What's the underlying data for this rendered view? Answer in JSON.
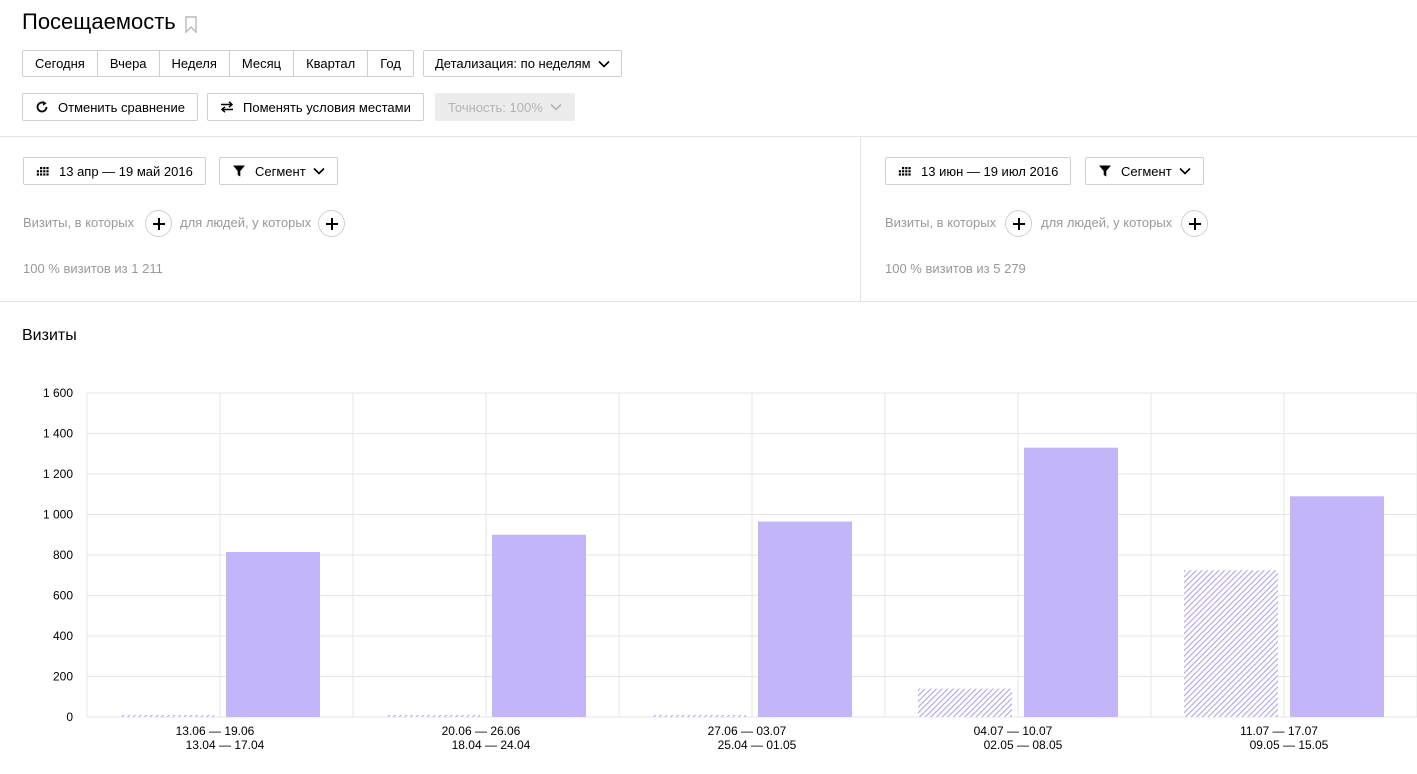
{
  "header": {
    "title": "Посещаемость"
  },
  "periods": [
    "Сегодня",
    "Вчера",
    "Неделя",
    "Месяц",
    "Квартал",
    "Год"
  ],
  "detail_label": "Детализация: по неделям",
  "actions": {
    "cancel_compare": "Отменить сравнение",
    "swap": "Поменять условия местами",
    "accuracy": "Точность: 100%"
  },
  "segment_left": {
    "date_range": "13 апр — 19 май 2016",
    "segment_label": "Сегмент",
    "visits_which": "Визиты, в которых",
    "people_which": "для людей, у которых",
    "summary": "100 % визитов из 1 211"
  },
  "segment_right": {
    "date_range": "13 июн — 19 июл 2016",
    "segment_label": "Сегмент",
    "visits_which": "Визиты, в которых",
    "people_which": "для людей, у которых",
    "summary": "100 % визитов из 5 279"
  },
  "chart_title": "Визиты",
  "colors": {
    "bar": "#c4b5f8",
    "hatch": "#b3a3e6",
    "grid": "#e6e6e6"
  },
  "chart_data": {
    "type": "bar",
    "title": "Визиты",
    "ylim": [
      0,
      1600
    ],
    "yticks": [
      0,
      200,
      400,
      600,
      800,
      1000,
      1200,
      1400,
      1600
    ],
    "ytick_labels": [
      "0",
      "200",
      "400",
      "600",
      "800",
      "1 000",
      "1 200",
      "1 400",
      "1 600"
    ],
    "categories": [
      [
        "13.06 — 19.06",
        "13.04 — 17.04"
      ],
      [
        "20.06 — 26.06",
        "18.04 — 24.04"
      ],
      [
        "27.06 — 03.07",
        "25.04 — 01.05"
      ],
      [
        "04.07 — 10.07",
        "02.05 — 08.05"
      ],
      [
        "11.07 — 17.07",
        "09.05 — 15.05"
      ]
    ],
    "series": [
      {
        "style": "hatched",
        "values": [
          10,
          10,
          10,
          140,
          725
        ]
      },
      {
        "style": "solid",
        "values": [
          815,
          900,
          965,
          1330,
          1090
        ]
      }
    ],
    "grid": true
  }
}
